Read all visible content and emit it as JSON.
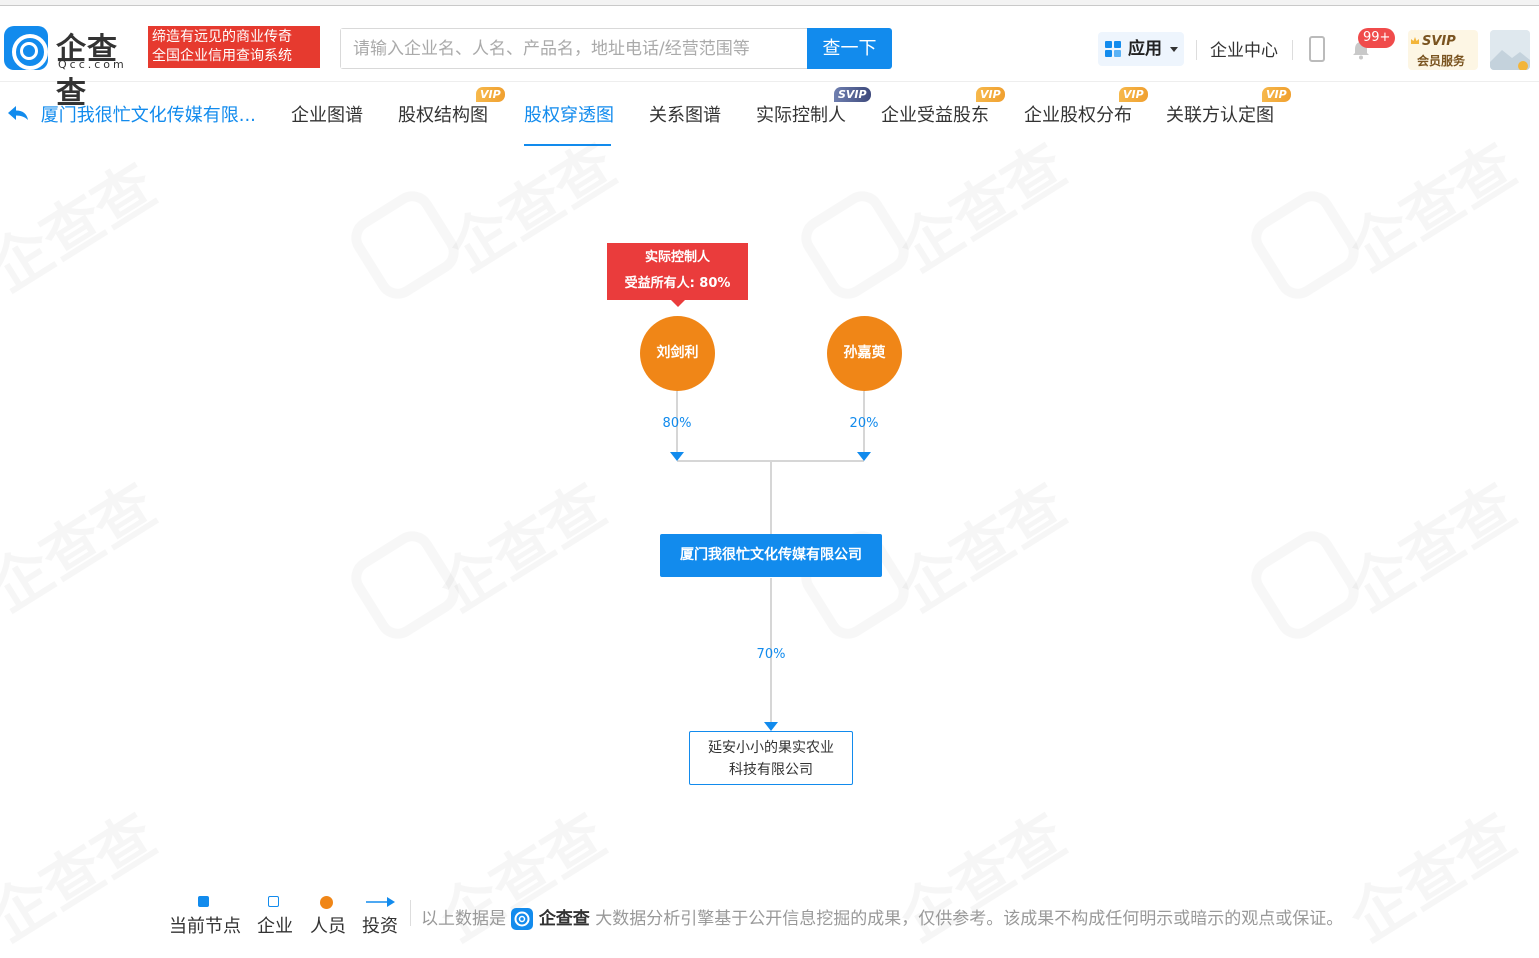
{
  "header": {
    "logo_text": "企查查",
    "logo_sub": "Qcc.com",
    "slogan_line1": "缔造有远见的商业传奇",
    "slogan_line2": "全国企业信用查询系统",
    "search_placeholder": "请输入企业名、人名、产品名，地址电话/经营范围等",
    "search_button": "查一下",
    "apps_label": "应用",
    "enterprise_center": "企业中心",
    "notification_badge": "99+",
    "svip_title": "SVIP",
    "svip_sub": "会员服务"
  },
  "nav": {
    "back_label": "厦门我很忙文化传媒有限...",
    "tabs": [
      {
        "label": "企业图谱",
        "badge": ""
      },
      {
        "label": "股权结构图",
        "badge": "VIP"
      },
      {
        "label": "股权穿透图",
        "badge": ""
      },
      {
        "label": "关系图谱",
        "badge": ""
      },
      {
        "label": "实际控制人",
        "badge": "SVIP"
      },
      {
        "label": "企业受益股东",
        "badge": "VIP"
      },
      {
        "label": "企业股权分布",
        "badge": "VIP"
      },
      {
        "label": "关联方认定图",
        "badge": "VIP"
      }
    ],
    "active_tab": "股权穿透图"
  },
  "graph": {
    "tooltip_line1": "实际控制人",
    "tooltip_line2": "受益所有人: 80%",
    "shareholders": [
      {
        "name": "刘剑利",
        "percent": "80%"
      },
      {
        "name": "孙嘉萸",
        "percent": "20%"
      }
    ],
    "current_company": "厦门我很忙文化传媒有限公司",
    "investment_percent": "70%",
    "invested_company_line1": "延安小小的果实农业",
    "invested_company_line2": "科技有限公司"
  },
  "colors": {
    "primary": "#128bed",
    "person": "#f08617",
    "controller_tag": "#ea3c3c",
    "slogan_bg": "#e63a2f"
  },
  "legend": {
    "current_node": "当前节点",
    "company": "企业",
    "person": "人员",
    "investment": "投资"
  },
  "footer": {
    "disclaimer_prefix": "以上数据是",
    "disclaimer_logo": "企查查",
    "disclaimer_suffix": "大数据分析引擎基于公开信息挖掘的成果，仅供参考。该成果不构成任何明示或暗示的观点或保证。"
  }
}
